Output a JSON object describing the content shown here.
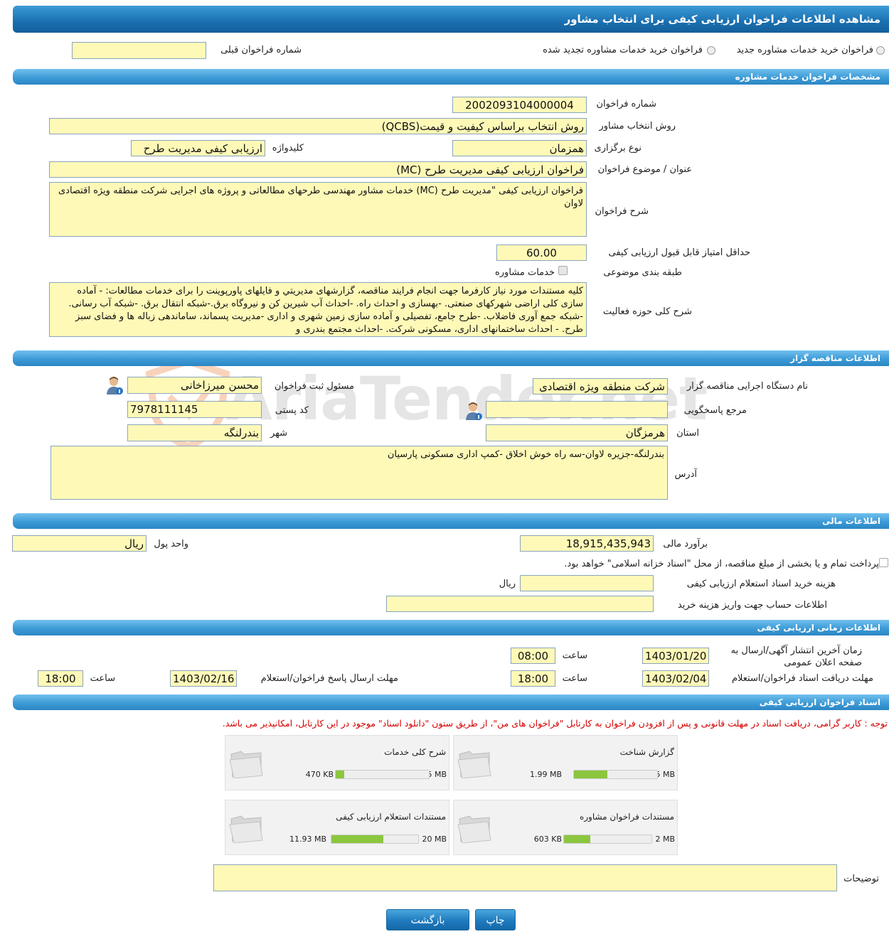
{
  "title": "مشاهده اطلاعات فراخوان ارزیابی کیفی برای انتخاب مشاور",
  "top": {
    "radio_new": "فراخوان خرید خدمات مشاوره جدید",
    "radio_renewed": "فراخوان خرید خدمات مشاوره تجدید شده",
    "prev_label": "شماره فراخوان قبلی",
    "prev_value": ""
  },
  "s1": {
    "header": "مشخصات فراخوان خدمات مشاوره",
    "number_label": "شماره فراخوان",
    "number": "2002093104000004",
    "method_label": "روش انتخاب مشاور",
    "method": "روش انتخاب براساس کیفیت و قیمت(QCBS)",
    "type_label": "نوع برگزاری",
    "type": "همزمان",
    "keyword_label": "کلیدواژه",
    "keyword": "ارزیابی کیفی مدیریت طرح",
    "subject_label": "عنوان / موضوع فراخوان",
    "subject": "فراخوان ارزیابی کیفی مدیریت طرح (MC)",
    "desc_label": "شرح فراخوان",
    "desc": "فراخوان ارزیابی کیفی \"مدیریت طرح (MC) خدمات مشاور مهندسی طرحهای مطالعاتی و پروژه های اجرایی شرکت منطقه ویژه اقتصادی لاوان",
    "minscore_label": "حداقل امتیاز قابل قبول ارزیابی کیفی",
    "minscore": "60.00",
    "category_label": "طبقه بندی موضوعی",
    "category": "خدمات مشاوره",
    "scope_label": "شرح کلی حوزه فعالیت",
    "scope": "کلیه مستندات مورد نیاز کارفرما جهت انجام فرایند مناقصه، گزارشهای مدیریتي و فایلهای پاورپوینت را برای خدمات مطالعات: - آماده سازی کلی اراضی شهرکهای صنعتی. -بهسازی و احداث راه. -احداث آب شیرین کن و نیروگاه برق.-شبکه انتقال برق. -شبکه آب رسانی. -شبکه جمع آوری فاضلاب. -طرح جامع، تفصیلی و آماده سازی زمین شهری و اداری -مدیریت پسماند، ساماندهی زباله ها و فضای سبز طرح. - احداث ساختمانهای اداری، مسکونی شرکت. -احداث مجتمع بندری و"
  },
  "s2": {
    "header": "اطلاعات مناقصه گزار",
    "org_label": "نام دستگاه اجرایی مناقصه گزار",
    "org": "شرکت منطقه ویژه اقتصادی",
    "reg_label": "مسئول ثبت فراخوان",
    "reg": "محسن میرزاخانی",
    "ref_label": "مرجع پاسخگویی",
    "ref": "",
    "postal_label": "کد پستی",
    "postal": "7978111145",
    "province_label": "استان",
    "province": "هرمزگان",
    "city_label": "شهر",
    "city": "بندرلنگه",
    "address_label": "آدرس",
    "address": "بندرلنگه-جزیره لاوان-سه راه خوش اخلاق -کمپ اداری مسکونی پارسیان"
  },
  "s3": {
    "header": "اطلاعات مالی",
    "estimate_label": "برآورد مالی",
    "estimate": "18,915,435,943",
    "currency_label": "واحد پول",
    "currency": "ریال",
    "treasury_text": "پرداخت تمام و یا بخشی از مبلغ مناقصه، از محل \"اسناد خزانه اسلامی\" خواهد بود.",
    "fee_label": "هزینه خرید اسناد استعلام ارزیابی کیفی",
    "fee": "",
    "fee_unit": "ریال",
    "account_label": "اطلاعات حساب جهت واریز هزینه خرید",
    "account": ""
  },
  "s4": {
    "header": "اطلاعات زمانی ارزیابی کیفی",
    "publish_label": "زمان آخرین انتشار آگهی/ارسال به صفحه اعلان عمومی",
    "publish_date": "1403/01/20",
    "publish_time": "08:00",
    "time_label": "ساعت",
    "receive_label": "مهلت دریافت اسناد فراخوان/استعلام",
    "receive_date": "1403/02/04",
    "receive_time": "18:00",
    "send_label": "مهلت ارسال پاسخ فراخوان/استعلام",
    "send_date": "1403/02/16",
    "send_time": "18:00"
  },
  "s5": {
    "header": "اسناد فراخوان ارزیابی کیفی",
    "note": "توجه : کاربر گرامی، دریافت اسناد در مهلت قانونی و پس از افزودن فراخوان به کارتابل \"فراخوان های من\"، از طریق ستون \"دانلود اسناد\" موجود در این کارتابل، امکانپذیر می باشد.",
    "docs": [
      {
        "name": "گزارش شناخت",
        "size": "1.99 MB",
        "max": "5 MB",
        "ratio": 0.398
      },
      {
        "name": "شرح کلی خدمات",
        "size": "470 KB",
        "max": "5 MB",
        "ratio": 0.094
      },
      {
        "name": "مستندات فراخوان مشاوره",
        "size": "603 KB",
        "max": "2 MB",
        "ratio": 0.3
      },
      {
        "name": "مستندات استعلام ارزیابی کیفی",
        "size": "11.93 MB",
        "max": "20 MB",
        "ratio": 0.6
      }
    ],
    "notes_label": "توضیحات",
    "notes": ""
  },
  "buttons": {
    "print": "چاپ",
    "back": "بازگشت"
  },
  "watermark": "AriaTender.net",
  "colors": {
    "field": "#fff9b8",
    "header": "#1a6fb0",
    "progress": "#8cc63f",
    "note": "#d40000"
  }
}
